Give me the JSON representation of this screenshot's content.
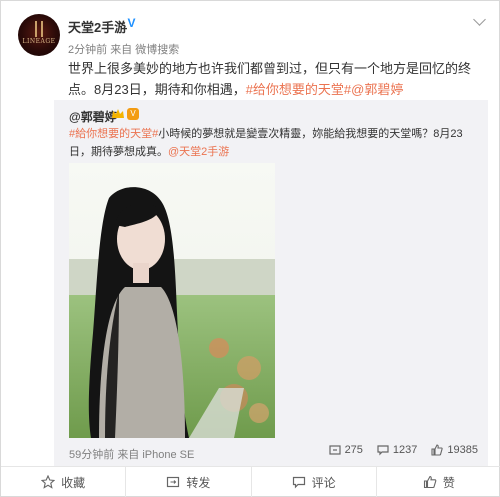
{
  "post": {
    "username": "天堂2手游",
    "verified_mark": "V",
    "time": "2分钟前",
    "source_prefix": "来自",
    "source": "微博搜索",
    "text_plain": "世界上很多美妙的地方也许我们都曾到过，但只有一个地方是回忆的终点。8月23日，期待和你相遇，",
    "topic_link": "#给你想要的天堂#",
    "mention_link": "@郭碧婷",
    "avatar_logo_text": "LINEAGE"
  },
  "repost": {
    "username": "@郭碧婷",
    "vip_text": "V",
    "topic_link": "#給你想要的天堂#",
    "text_plain": "小時候的夢想就是變壹次精靈，妳能給我想要的天堂嗎？8月23日，期待夢想成真。",
    "mention_link": "@天堂2手游",
    "time": "59分钟前",
    "source": "来自 iPhone SE",
    "reposts": "275",
    "comments": "1237",
    "likes": "19385"
  },
  "actions": {
    "favorite": "收藏",
    "repost": "转发",
    "comment": "评论",
    "like": "赞"
  },
  "icons": {
    "dropdown": "chevron-down-icon",
    "favorite": "star-icon",
    "repost": "repost-icon",
    "comment": "comment-icon",
    "like": "thumbs-up-icon"
  },
  "colors": {
    "link": "#eb7350",
    "verified": "#1e90ff",
    "repost_bg": "#f2f2f5"
  }
}
